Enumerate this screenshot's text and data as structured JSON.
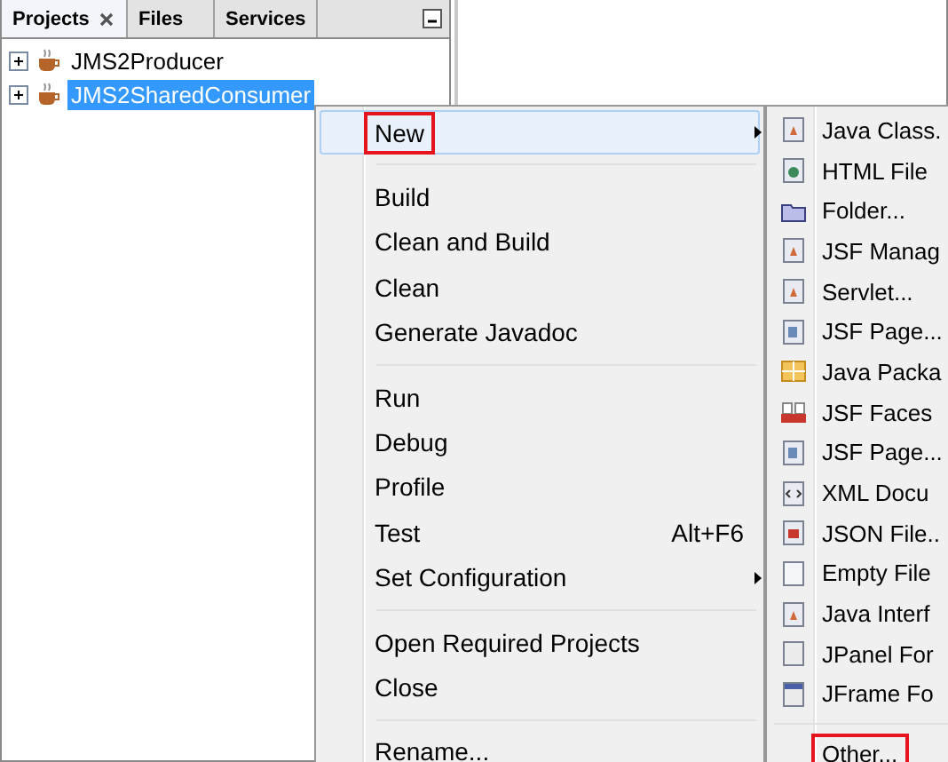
{
  "tabs": [
    {
      "label": "Projects",
      "selected": true
    },
    {
      "label": "Files",
      "selected": false
    },
    {
      "label": "Services",
      "selected": false
    }
  ],
  "tree": [
    {
      "label": "JMS2Producer",
      "selected": false
    },
    {
      "label": "JMS2SharedConsumer",
      "selected": true
    }
  ],
  "context_menu": {
    "groups": [
      [
        {
          "label": "New",
          "selected": true,
          "highlighted": true,
          "submenu": true
        }
      ],
      [
        {
          "label": "Build",
          "selected": false
        },
        {
          "label": "Clean and Build",
          "selected": false
        },
        {
          "label": "Clean",
          "selected": false
        },
        {
          "label": "Generate Javadoc",
          "selected": false
        }
      ],
      [
        {
          "label": "Run",
          "selected": false
        },
        {
          "label": "Debug",
          "selected": false
        },
        {
          "label": "Profile",
          "selected": false
        },
        {
          "label": "Test",
          "shortcut": "Alt+F6",
          "selected": false
        },
        {
          "label": "Set Configuration",
          "submenu": true,
          "selected": false
        }
      ],
      [
        {
          "label": "Open Required Projects",
          "selected": false
        },
        {
          "label": "Close",
          "selected": false
        }
      ],
      [
        {
          "label": "Rename...",
          "selected": false
        }
      ]
    ]
  },
  "submenu": {
    "groups": [
      [
        {
          "label": "Java Class.",
          "kind": "class"
        },
        {
          "label": "HTML File",
          "kind": "html"
        },
        {
          "label": "Folder...",
          "kind": "folder"
        },
        {
          "label": "JSF Manag",
          "kind": "class"
        },
        {
          "label": "Servlet...",
          "kind": "class"
        },
        {
          "label": "JSF Page...",
          "kind": "page"
        },
        {
          "label": "Java Packa",
          "kind": "package"
        },
        {
          "label": "JSF Faces",
          "kind": "jsf"
        },
        {
          "label": "JSF Page...",
          "kind": "page"
        },
        {
          "label": "XML Docu",
          "kind": "xml"
        },
        {
          "label": "JSON File..",
          "kind": "json"
        },
        {
          "label": "Empty File",
          "kind": "file"
        },
        {
          "label": "Java Interf",
          "kind": "class"
        },
        {
          "label": "JPanel For",
          "kind": "panel"
        },
        {
          "label": "JFrame Fo",
          "kind": "frame"
        }
      ],
      [
        {
          "label": "Other...",
          "kind": "none",
          "highlighted": true
        }
      ]
    ]
  }
}
